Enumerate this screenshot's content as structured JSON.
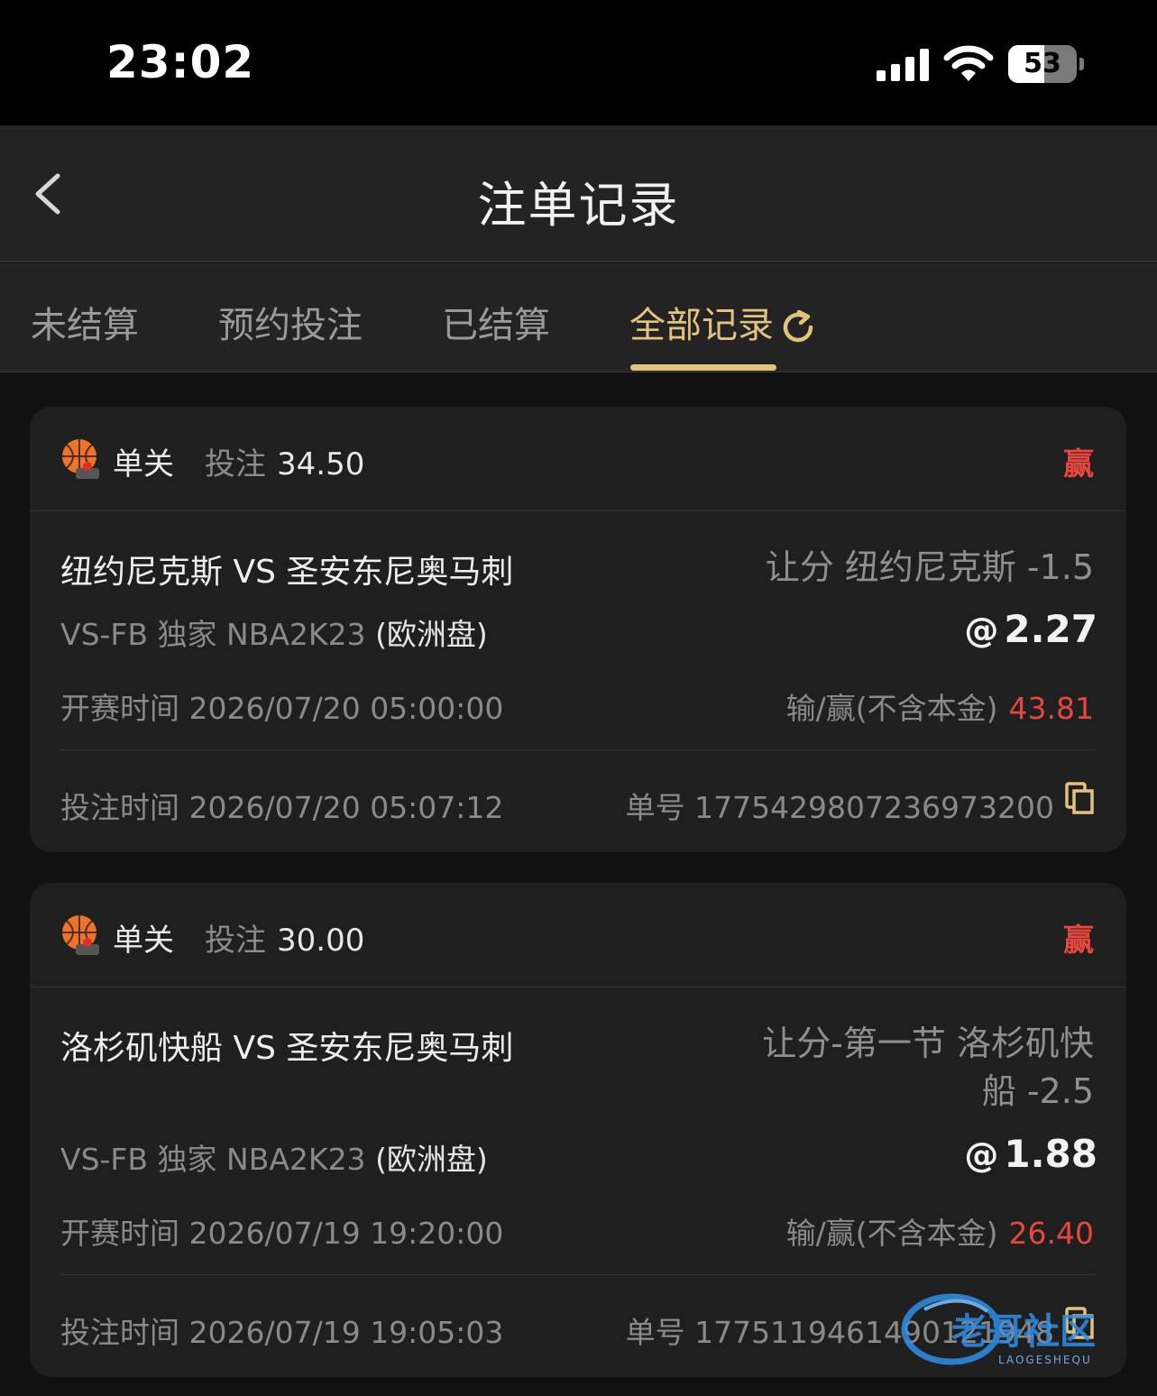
{
  "status_bar": {
    "time": "23:02",
    "battery": "53",
    "battery_level": 0.53,
    "icons": [
      "cellular-signal-icon",
      "wifi-icon",
      "battery-icon"
    ]
  },
  "nav": {
    "title": "注单记录",
    "back_icon": "chevron-left-icon"
  },
  "tabs": [
    {
      "label": "未结算",
      "active": false
    },
    {
      "label": "预约投注",
      "active": false
    },
    {
      "label": "已结算",
      "active": false
    },
    {
      "label": "全部记录",
      "active": true,
      "icon": "refresh-icon"
    }
  ],
  "colors": {
    "accent": "#e3c27c",
    "win": "#e7473d",
    "card_bg": "#1f1f20",
    "page_bg": "#111112"
  },
  "bets": [
    {
      "sport_icon": "basketball-icon",
      "type": "单关",
      "stake_label": "投注",
      "stake": "34.50",
      "result": "赢",
      "match": "纽约尼克斯 VS 圣安东尼奥马刺",
      "league": "VS-FB 独家 NBA2K23",
      "odds_type": "(欧洲盘)",
      "market_line1": "让分 纽约尼克斯 -1.5",
      "market_line2": "",
      "at": "@",
      "odds": "2.27",
      "start_label": "开赛时间",
      "start_time": "2026/07/20 05:00:00",
      "winloss_label": "输/赢(不含本金)",
      "winloss": "43.81",
      "bet_time_label": "投注时间",
      "bet_time": "2026/07/20 05:07:12",
      "order_label": "单号",
      "order_no": "1775429807236973200"
    },
    {
      "sport_icon": "basketball-icon",
      "type": "单关",
      "stake_label": "投注",
      "stake": "30.00",
      "result": "赢",
      "match": "洛杉矶快船 VS 圣安东尼奥马刺",
      "league": "VS-FB 独家 NBA2K23",
      "odds_type": "(欧洲盘)",
      "market_line1": "让分-第一节 洛杉矶快",
      "market_line2": "船 -2.5",
      "at": "@",
      "odds": "1.88",
      "start_label": "开赛时间",
      "start_time": "2026/07/19 19:20:00",
      "winloss_label": "输/赢(不含本金)",
      "winloss": "26.40",
      "bet_time_label": "投注时间",
      "bet_time": "2026/07/19 19:05:03",
      "order_label": "单号",
      "order_no": "1775119461490121948"
    }
  ],
  "watermark": {
    "text": "老哥社区",
    "subtext": "LAOGESHEQU"
  }
}
